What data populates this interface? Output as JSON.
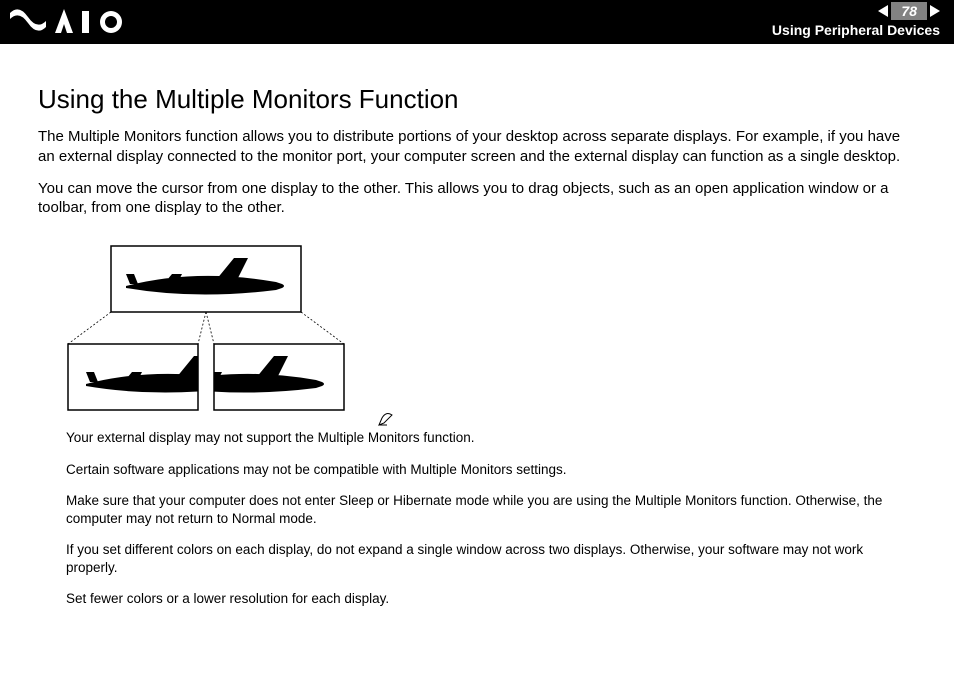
{
  "header": {
    "page_number": "78",
    "section": "Using Peripheral Devices"
  },
  "title": "Using the Multiple Monitors Function",
  "paragraphs": [
    "The Multiple Monitors function allows you to distribute portions of your desktop across separate displays. For example, if you have an external display connected to the monitor port, your computer screen and the external display can function as a single desktop.",
    "You can move the cursor from one display to the other. This allows you to drag objects, such as an open application window or a toolbar, from one display to the other."
  ],
  "notes": [
    "Your external display may not support the Multiple Monitors function.",
    "Certain software applications may not be compatible with Multiple Monitors settings.",
    "Make sure that your computer does not enter Sleep or Hibernate mode while you are using the Multiple Monitors function. Otherwise, the computer may not return to Normal mode.",
    "If you set different colors on each display, do not expand a single window across two displays. Otherwise, your software may not work properly.",
    "Set fewer colors or a lower resolution for each display."
  ]
}
